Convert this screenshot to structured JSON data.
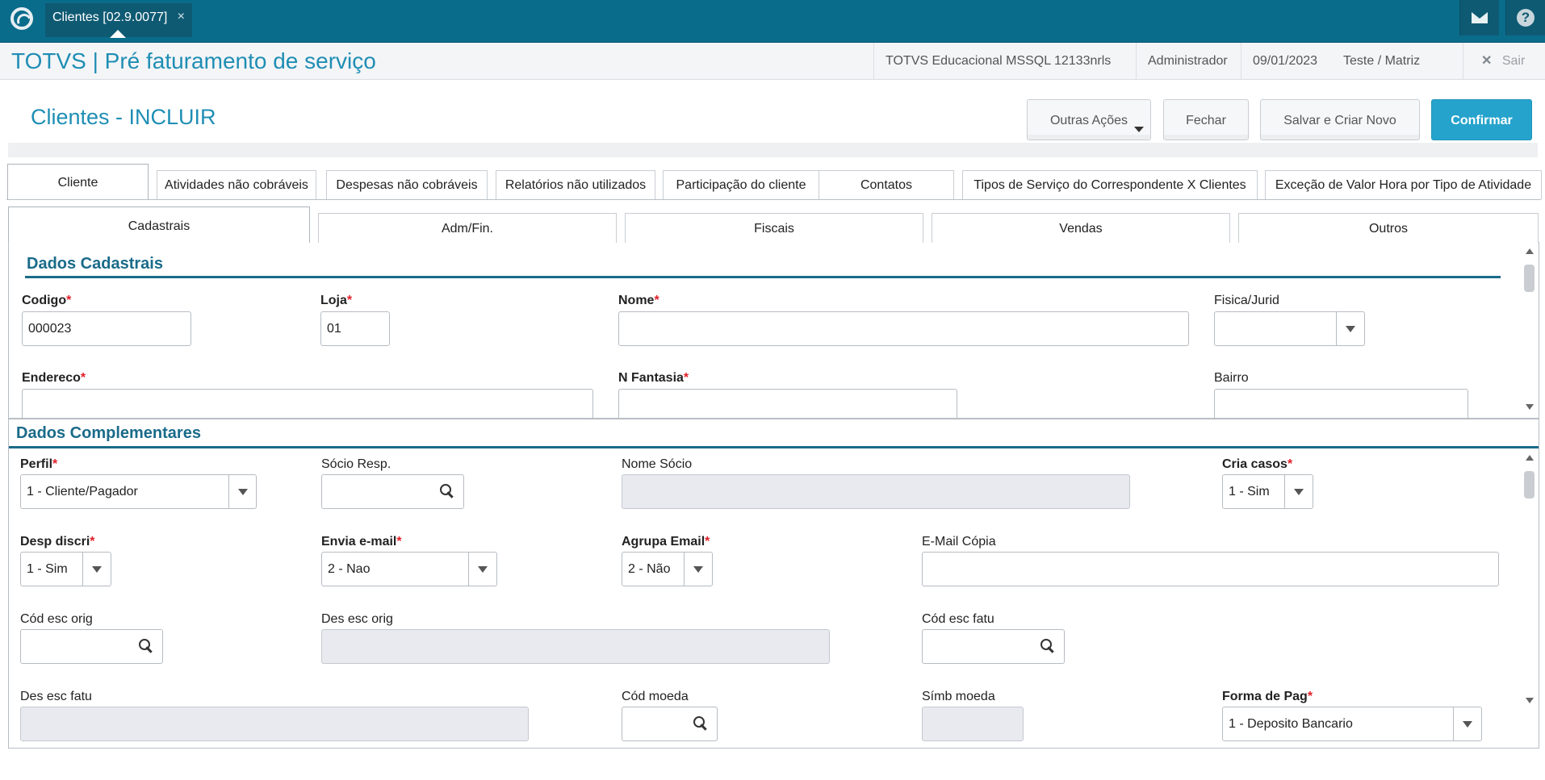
{
  "topbar": {
    "app_tab_label": "Clientes [02.9.0077]",
    "app_tab_close": "×",
    "logo_icon": "totvs-logo-icon",
    "mail_icon": "mail-icon",
    "help_icon": "help-icon",
    "help_glyph": "?"
  },
  "header": {
    "app_title": "TOTVS | Pré faturamento de serviço",
    "environment": "TOTVS Educacional MSSQL 12133nrls",
    "user": "Administrador",
    "date": "09/01/2023",
    "company": "Teste / Matriz",
    "exit_label": "Sair",
    "exit_glyph": "✕"
  },
  "page": {
    "title": "Clientes - INCLUIR"
  },
  "toolbar": {
    "outras_acoes": "Outras Ações",
    "fechar": "Fechar",
    "salvar_criar_novo": "Salvar e Criar Novo",
    "confirmar": "Confirmar"
  },
  "tabs_main": [
    "Cliente",
    "Atividades não cobráveis",
    "Despesas não cobráveis",
    "Relatórios não utilizados",
    "Participação do cliente",
    "Contatos",
    "Tipos de Serviço do Correspondente X Clientes",
    "Exceção de Valor Hora por Tipo de Atividade"
  ],
  "tabs_sub": [
    "Cadastrais",
    "Adm/Fin.",
    "Fiscais",
    "Vendas",
    "Outros"
  ],
  "dados_cadastrais": {
    "title": "Dados Cadastrais",
    "codigo": {
      "label": "Codigo",
      "value": "000023"
    },
    "loja": {
      "label": "Loja",
      "value": "01"
    },
    "nome": {
      "label": "Nome",
      "value": ""
    },
    "fisica_jurid": {
      "label": "Fisica/Jurid",
      "value": ""
    },
    "endereco": {
      "label": "Endereco",
      "value": ""
    },
    "n_fantasia": {
      "label": "N Fantasia",
      "value": ""
    },
    "bairro": {
      "label": "Bairro",
      "value": ""
    }
  },
  "dados_complementares": {
    "title": "Dados Complementares",
    "perfil": {
      "label": "Perfil",
      "value": "1 - Cliente/Pagador"
    },
    "socio_resp": {
      "label": "Sócio Resp.",
      "value": ""
    },
    "nome_socio": {
      "label": "Nome Sócio",
      "value": ""
    },
    "cria_casos": {
      "label": "Cria casos",
      "value": "1 - Sim"
    },
    "desp_discri": {
      "label": "Desp discri",
      "value": "1 - Sim"
    },
    "envia_email": {
      "label": "Envia e-mail",
      "value": "2 - Nao"
    },
    "agrupa_email": {
      "label": "Agrupa Email",
      "value": "2 - Não"
    },
    "email_copia": {
      "label": "E-Mail Cópia",
      "value": ""
    },
    "cod_esc_orig": {
      "label": "Cód esc orig",
      "value": ""
    },
    "des_esc_orig": {
      "label": "Des esc orig",
      "value": ""
    },
    "cod_esc_fatu": {
      "label": "Cód esc fatu",
      "value": ""
    },
    "des_esc_fatu": {
      "label": "Des esc fatu",
      "value": ""
    },
    "cod_moeda": {
      "label": "Cód moeda",
      "value": ""
    },
    "simb_moeda": {
      "label": "Símb moeda",
      "value": ""
    },
    "forma_pag": {
      "label": "Forma de Pag",
      "value": "1 - Deposito Bancario"
    }
  },
  "required_mark": "*",
  "colors": {
    "topbar": "#0a6c8b",
    "accent": "#1f8eb4",
    "confirm": "#25a3cc",
    "section": "#1a6b8a",
    "required": "#e0202a"
  }
}
